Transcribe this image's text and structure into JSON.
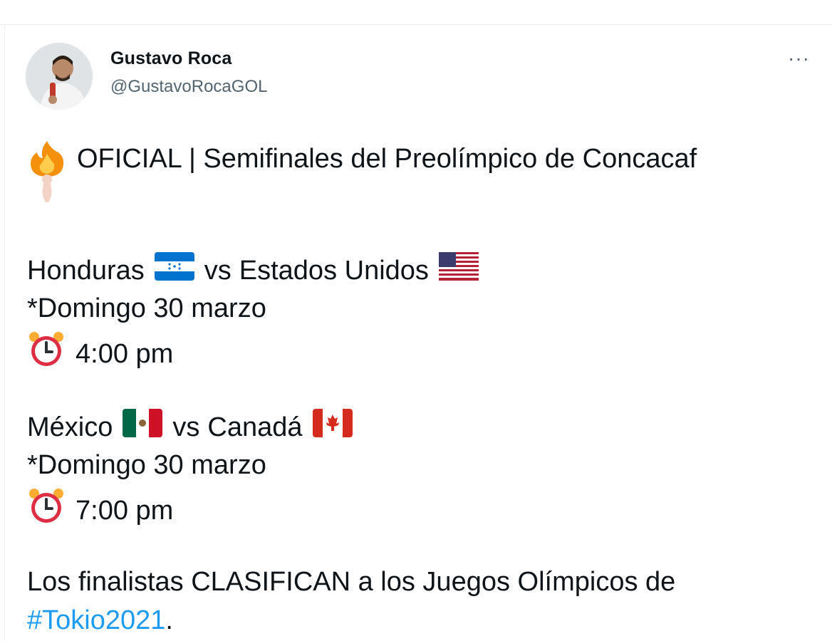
{
  "author": {
    "name": "Gustavo Roca",
    "handle": "@GustavoRocaGOL"
  },
  "menu": {
    "more_label": "···"
  },
  "tweet": {
    "headline": "OFICIAL | Semifinales del Preolímpico de Concacaf",
    "headline_icon": "fire-icon",
    "match1": {
      "team1": "Honduras",
      "team1_flag": "honduras-flag-icon",
      "vs": "vs",
      "team2": "Estados Unidos",
      "team2_flag": "usa-flag-icon",
      "date": "*Domingo 30 marzo",
      "time": "4:00 pm"
    },
    "match2": {
      "team1": "México",
      "team1_flag": "mexico-flag-icon",
      "vs": "vs",
      "team2": "Canadá",
      "team2_flag": "canada-flag-icon",
      "date": "*Domingo 30 marzo",
      "time": "7:00 pm"
    },
    "footer": "Los finalistas CLASIFICAN a los Juegos Olímpicos de",
    "hashtag": "#Tokio2021",
    "hashtag_suffix": "."
  },
  "colors": {
    "hashtag": "#1d9bf0",
    "handle": "#536471",
    "clock": "#dd2e44"
  }
}
